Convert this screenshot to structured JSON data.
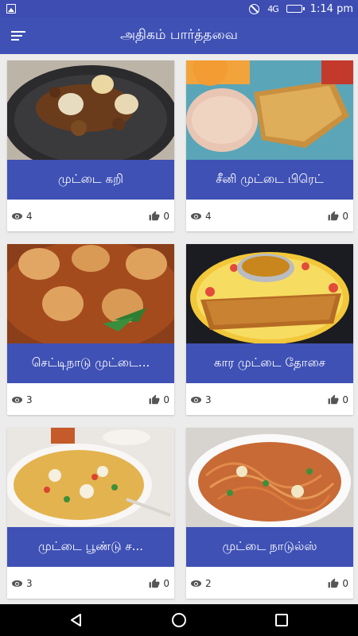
{
  "status_bar": {
    "time": "1:14 pm",
    "signal": "4G",
    "icons": [
      "image-icon",
      "do-not-disturb-icon",
      "signal-icon",
      "battery-icon"
    ]
  },
  "app_bar": {
    "title": "அதிகம் பார்த்தவை",
    "menu_icon": "menu-icon"
  },
  "recipes": [
    {
      "title": "முட்டை கறி",
      "views": "4",
      "likes": "0",
      "photo": "egg curry in pan"
    },
    {
      "title": "சீனி முட்டை பிரெட்",
      "views": "4",
      "likes": "0",
      "photo": "sweet egg bread"
    },
    {
      "title": "செட்டிநாடு முட்டை...",
      "views": "3",
      "likes": "0",
      "photo": "chettinad egg gravy"
    },
    {
      "title": "கார முட்டை தோசை",
      "views": "3",
      "likes": "0",
      "photo": "egg dosa"
    },
    {
      "title": "முட்டை பூண்டு ச...",
      "views": "3",
      "likes": "0",
      "photo": "egg garlic rice"
    },
    {
      "title": "முட்டை நாடுல்ஸ்",
      "views": "2",
      "likes": "0",
      "photo": "egg noodles"
    }
  ],
  "colors": {
    "primary": "#3f51b5",
    "status": "#3d4db2",
    "background": "#ececec"
  }
}
